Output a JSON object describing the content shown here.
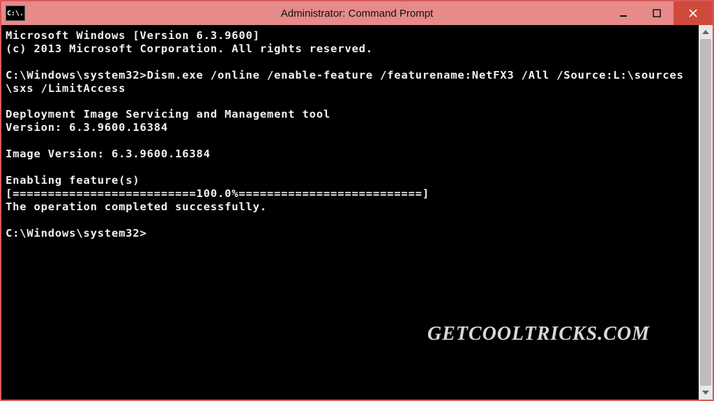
{
  "titlebar": {
    "sys_icon_text": "C:\\.",
    "title": "Administrator: Command Prompt"
  },
  "console": {
    "lines": [
      "Microsoft Windows [Version 6.3.9600]",
      "(c) 2013 Microsoft Corporation. All rights reserved.",
      "",
      "C:\\Windows\\system32>Dism.exe /online /enable-feature /featurename:NetFX3 /All /Source:L:\\sources\\sxs /LimitAccess",
      "",
      "Deployment Image Servicing and Management tool",
      "Version: 6.3.9600.16384",
      "",
      "Image Version: 6.3.9600.16384",
      "",
      "Enabling feature(s)",
      "[==========================100.0%==========================]",
      "The operation completed successfully.",
      "",
      "C:\\Windows\\system32>"
    ]
  },
  "watermark": "GETCOOLTRICKS.COM"
}
